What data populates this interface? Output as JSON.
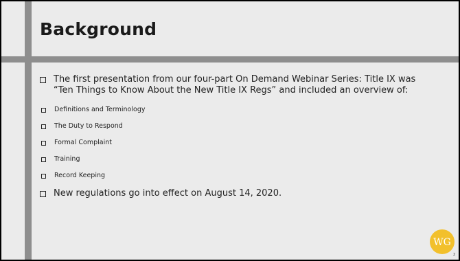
{
  "slide": {
    "title": "Background",
    "bullets": [
      {
        "text": "The first presentation from our four-part On Demand Webinar Series: Title IX was “Ten Things to Know About the New Title IX Regs” and included an overview of:",
        "sub_bullets": [
          "Definitions and Terminology",
          "The Duty to Respond",
          "Formal Complaint",
          "Training",
          "Record Keeping"
        ]
      },
      {
        "text": "New regulations go into effect on August 14, 2020."
      }
    ],
    "logo_text": "WG",
    "page_number": "2"
  },
  "colors": {
    "background": "#ebebeb",
    "frame": "#000000",
    "accent_bar": "#8e8e8e",
    "logo_circle": "#f2c02c",
    "logo_text": "#ffffff",
    "text": "#222222"
  },
  "icons": {
    "bullet": "hollow-square-bullet",
    "logo": "wg-circle-logo"
  }
}
